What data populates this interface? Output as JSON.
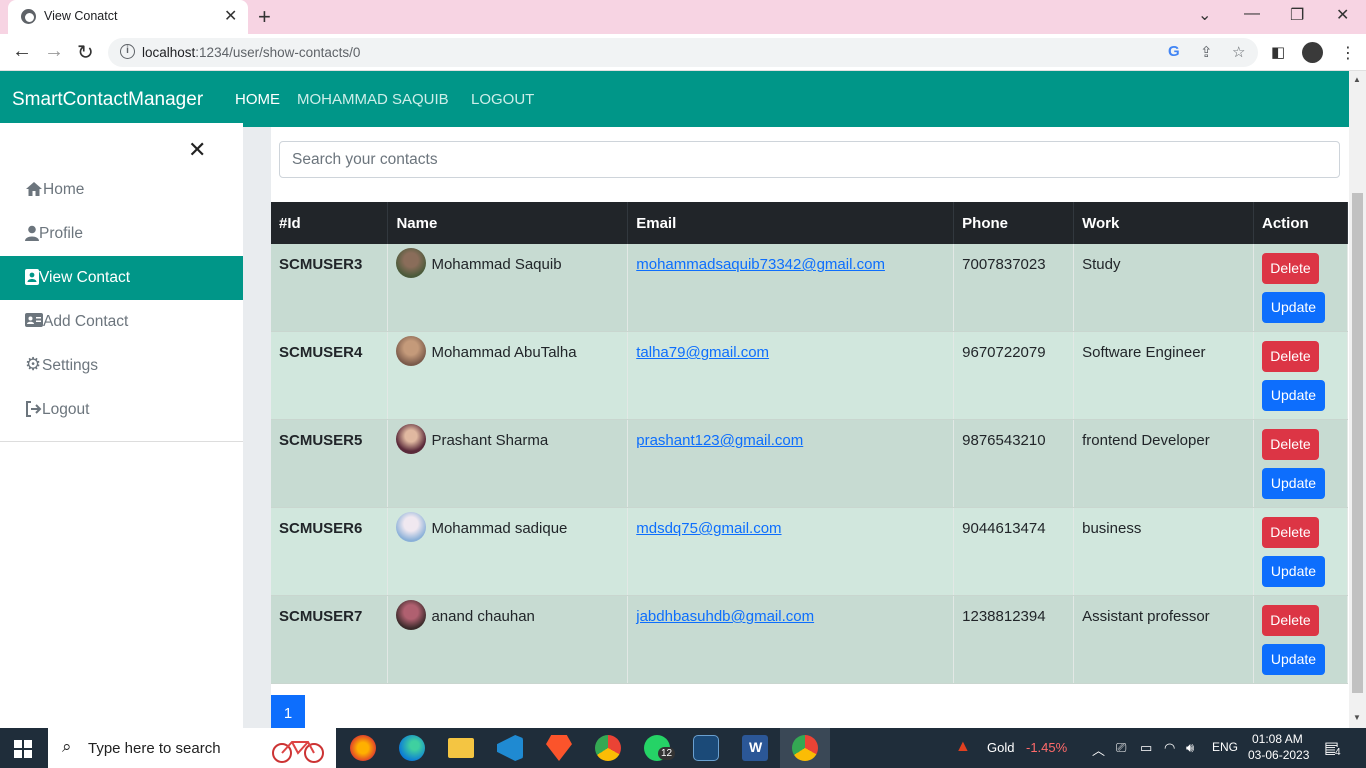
{
  "browser": {
    "tab_title": "View Conatct",
    "url_host": "localhost",
    "url_rest": ":1234/user/show-contacts/0"
  },
  "app": {
    "brand": "SmartContactManager",
    "nav": [
      "HOME",
      "MOHAMMAD SAQUIB",
      "LOGOUT"
    ]
  },
  "sidebar": {
    "items": [
      {
        "label": "Home",
        "icon": "home-icon"
      },
      {
        "label": "Profile",
        "icon": "user-icon"
      },
      {
        "label": "View Contact",
        "icon": "id-card-icon",
        "active": true
      },
      {
        "label": "Add Contact",
        "icon": "address-card-icon"
      },
      {
        "label": "Settings",
        "icon": "gear-icon"
      },
      {
        "label": "Logout",
        "icon": "logout-icon"
      }
    ]
  },
  "search": {
    "placeholder": "Search your contacts"
  },
  "table": {
    "headers": [
      "#Id",
      "Name",
      "Email",
      "Phone",
      "Work",
      "Action"
    ],
    "rows": [
      {
        "id": "SCMUSER3",
        "name": "Mohammad Saquib",
        "email": "mohammadsaquib73342@gmail.com",
        "phone": "7007837023",
        "work": "Study"
      },
      {
        "id": "SCMUSER4",
        "name": "Mohammad AbuTalha",
        "email": "talha79@gmail.com",
        "phone": "9670722079",
        "work": "Software Engineer"
      },
      {
        "id": "SCMUSER5",
        "name": "Prashant Sharma",
        "email": "prashant123@gmail.com",
        "phone": "9876543210",
        "work": "frontend Developer"
      },
      {
        "id": "SCMUSER6",
        "name": "Mohammad sadique",
        "email": "mdsdq75@gmail.com",
        "phone": "9044613474",
        "work": "business"
      },
      {
        "id": "SCMUSER7",
        "name": "anand chauhan",
        "email": "jabdhbasuhdb@gmail.com",
        "phone": "1238812394",
        "work": "Assistant professor"
      }
    ],
    "delete_label": "Delete",
    "update_label": "Update"
  },
  "pagination": {
    "current": "1"
  },
  "taskbar": {
    "search_placeholder": "Type here to search",
    "whatsapp_badge": "12",
    "gold_label": "Gold",
    "gold_change": "-1.45%",
    "lang": "ENG",
    "time": "01:08 AM",
    "date": "03-06-2023",
    "notification_count": "4"
  },
  "colors": {
    "navbar": "#009688",
    "delete": "#dc3545",
    "update": "#0d6efd",
    "tab_strip": "#f7d4e3"
  }
}
